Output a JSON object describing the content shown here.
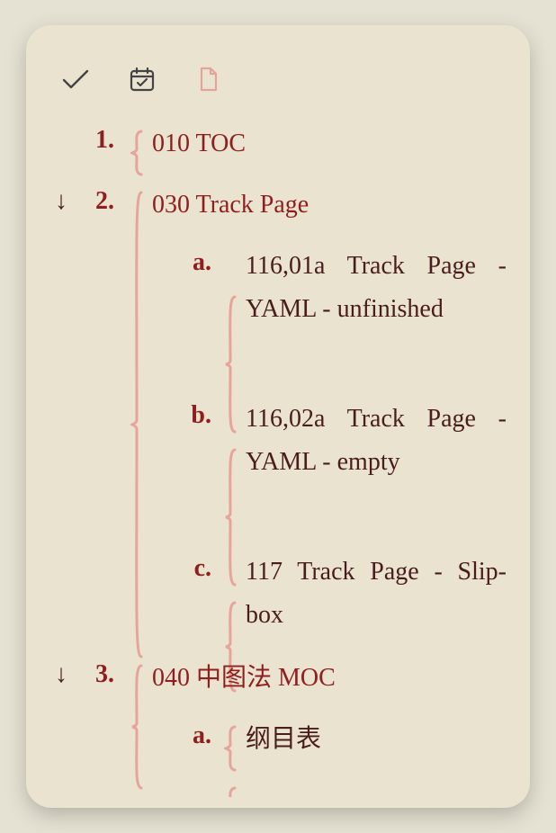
{
  "toolbar": {
    "check_name": "done-icon",
    "calendar_name": "calendar-icon",
    "document_name": "document-icon"
  },
  "outline": {
    "items": [
      {
        "marker": "1.",
        "arrow": "",
        "text": "010 TOC",
        "link": true,
        "children": []
      },
      {
        "marker": "2.",
        "arrow": "↓",
        "text": "030 Track Page",
        "link": true,
        "children": [
          {
            "marker": "a.",
            "text": "116,01a Track Page - YAML - unfinished",
            "link": false
          },
          {
            "marker": "b.",
            "text": "116,02a Track Page - YAML - empty",
            "link": false
          },
          {
            "marker": "c.",
            "text": "117 Track Page - Slip-box",
            "link": false
          }
        ]
      },
      {
        "marker": "3.",
        "arrow": "↓",
        "text": "040 中图法 MOC",
        "link": true,
        "children": [
          {
            "marker": "a.",
            "text": "纲目表",
            "link": false
          }
        ]
      }
    ]
  }
}
